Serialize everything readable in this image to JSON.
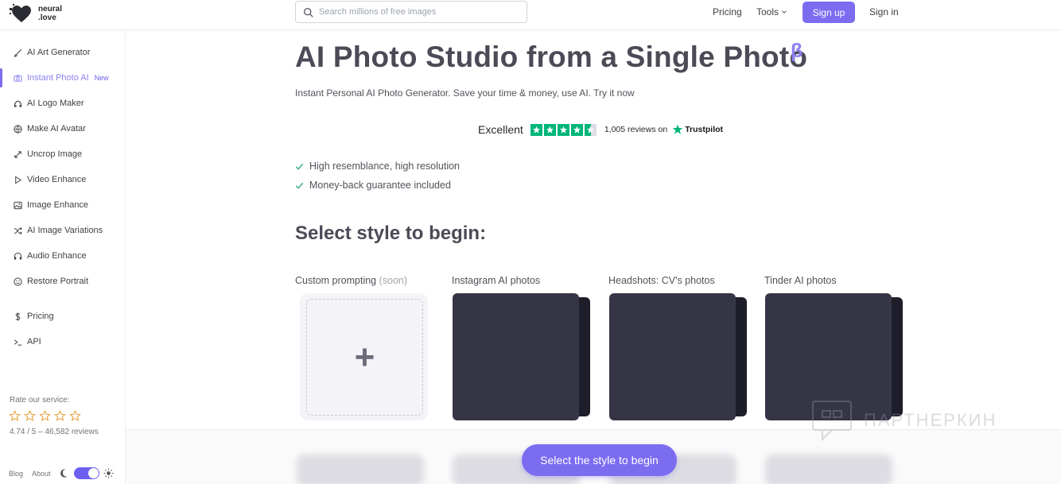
{
  "brand": {
    "name_line1": "neural",
    "name_line2": ".love",
    "logo_icon": "heart-pixel-logo"
  },
  "header": {
    "search_placeholder": "Search millions of free images",
    "nav_pricing": "Pricing",
    "nav_tools": "Tools",
    "signup": "Sign up",
    "signin": "Sign in"
  },
  "sidebar": {
    "items": [
      {
        "label": "AI Art Generator",
        "icon": "brush-icon"
      },
      {
        "label": "Instant Photo AI",
        "icon": "camera-icon",
        "badge": "New",
        "active": true
      },
      {
        "label": "AI Logo Maker",
        "icon": "logo-maker-icon"
      },
      {
        "label": "Make AI Avatar",
        "icon": "avatar-icon"
      },
      {
        "label": "Uncrop Image",
        "icon": "expand-icon"
      },
      {
        "label": "Video Enhance",
        "icon": "play-icon"
      },
      {
        "label": "Image Enhance",
        "icon": "image-icon"
      },
      {
        "label": "AI Image Variations",
        "icon": "shuffle-icon"
      },
      {
        "label": "Audio Enhance",
        "icon": "headphones-icon"
      },
      {
        "label": "Restore Portrait",
        "icon": "smile-icon"
      },
      {
        "label": "Pricing",
        "icon": "dollar-icon"
      },
      {
        "label": "API",
        "icon": "terminal-icon"
      }
    ],
    "rate_label": "Rate our service:",
    "rating_score": "4.74 / 5 – 46,582 reviews",
    "footer_blog": "Blog",
    "footer_about": "About",
    "theme_toggle_dark": true
  },
  "main": {
    "title": "AI Photo Studio from a Single Photo",
    "beta": "β",
    "subtitle": "Instant Personal AI Photo Generator. Save your time & money, use AI. Try it now",
    "trustpilot": {
      "excellent": "Excellent",
      "stars": 4.5,
      "reviews": "1,005 reviews on",
      "brand": "Trustpilot"
    },
    "features": [
      "High resemblance, high resolution",
      "Money-back guarantee included"
    ],
    "section_title": "Select style to begin:",
    "cards": [
      {
        "label": "Custom prompting",
        "suffix": "(soon)"
      },
      {
        "label": "Instagram AI photos"
      },
      {
        "label": "Headshots: CV's photos"
      },
      {
        "label": "Tinder AI photos"
      }
    ],
    "cta": "Select the style to begin"
  },
  "watermark": "ПАРТНЕРКИН",
  "colors": {
    "accent": "#7c6cf0",
    "trustpilot_green": "#00b67a",
    "card_dark": "#353545"
  }
}
